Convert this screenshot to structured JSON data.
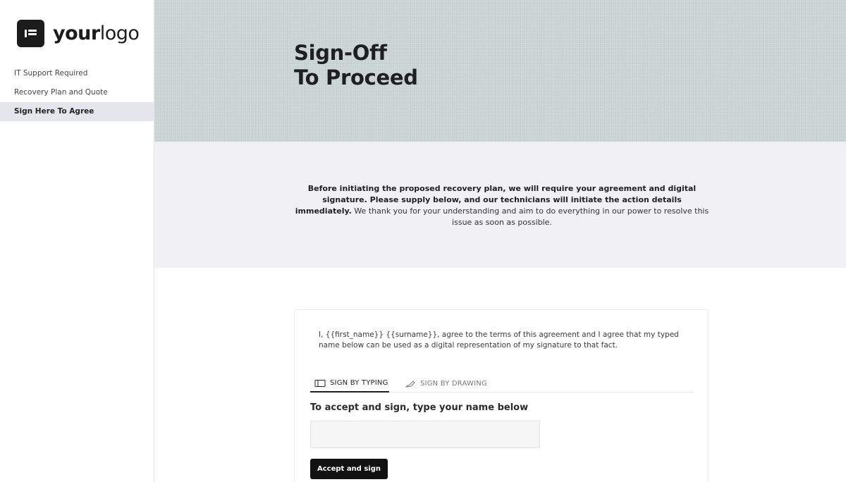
{
  "logo": {
    "text_bold": "your",
    "text_regular": "logo",
    "icon": "logo-mark-icon"
  },
  "sidebar": {
    "items": [
      {
        "label": "IT Support Required",
        "active": false
      },
      {
        "label": "Recovery Plan and Quote",
        "active": false
      },
      {
        "label": "Sign Here To Agree",
        "active": true
      }
    ]
  },
  "hero": {
    "title_line1": "Sign-Off",
    "title_line2": "To Proceed"
  },
  "intro": {
    "bold_text": "Before initiating the proposed recovery plan, we will require your agreement and digital signature. Please supply below, and our technicians will initiate the action details immediately.",
    "regular_text": " We thank you for your understanding and aim to do everything in our power to resolve this issue as soon as possible."
  },
  "signature": {
    "agreement_text": "I, {{first_name}} {{surname}}, agree to the terms of this agreement and I agree that my typed name below can be used as a digital representation of my signature to that fact.",
    "tabs": [
      {
        "label": "SIGN BY TYPING",
        "icon": "keyboard-icon",
        "active": true
      },
      {
        "label": "SIGN BY DRAWING",
        "icon": "pen-icon",
        "active": false
      }
    ],
    "heading": "To accept and sign, type your name below",
    "input_value": "",
    "input_placeholder": "",
    "accept_button": "Accept and sign"
  },
  "colors": {
    "hero_bg": "#c9d3d3",
    "intro_bg": "#f1f1f4",
    "active_nav_bg": "#e4e6ec",
    "button_bg": "#111111"
  }
}
